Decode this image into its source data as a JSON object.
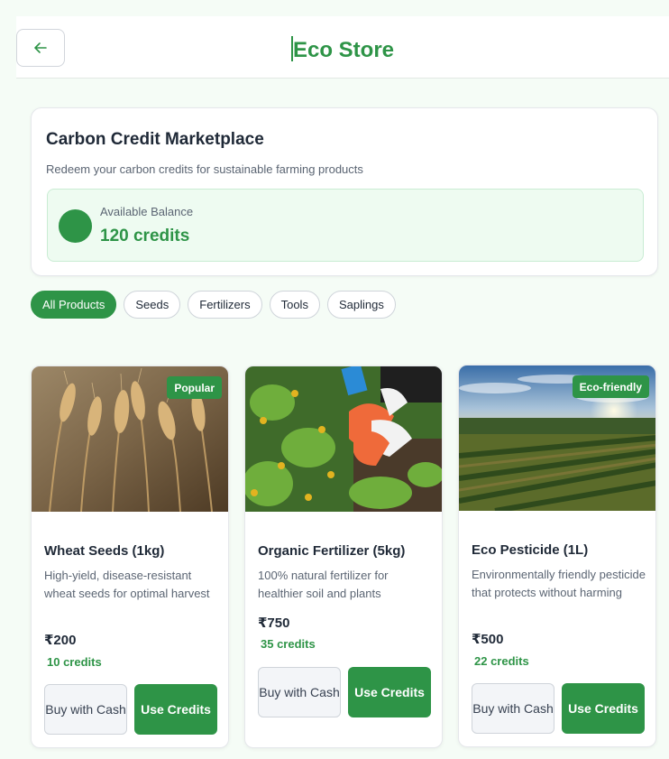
{
  "header": {
    "title": "Eco Store",
    "back_icon": "arrow-left-icon"
  },
  "marketplace": {
    "title": "Carbon Credit Marketplace",
    "subtitle": "Redeem your carbon credits for sustainable farming products",
    "balance_label": "Available Balance",
    "balance_value": "120 credits"
  },
  "filters": [
    "All Products",
    "Seeds",
    "Fertilizers",
    "Tools",
    "Saplings"
  ],
  "active_filter": "All Products",
  "products": [
    {
      "name": "Wheat Seeds (1kg)",
      "description": "High-yield, disease-resistant wheat seeds for optimal harvest",
      "price": "₹200",
      "credits": "10 credits",
      "badge": "Popular",
      "cash_label": "Buy with Cash",
      "credits_label": "Use Credits"
    },
    {
      "name": "Organic Fertilizer (5kg)",
      "description": "100% natural fertilizer for healthier soil and plants",
      "price": "₹750",
      "credits": "35 credits",
      "badge": "",
      "cash_label": "Buy with Cash",
      "credits_label": "Use Credits"
    },
    {
      "name": "Eco Pesticide (1L)",
      "description": "Environmentally friendly pesticide that protects without harming",
      "price": "₹500",
      "credits": "22 credits",
      "badge": "Eco-friendly",
      "cash_label": "Buy with Cash",
      "credits_label": "Use Credits"
    }
  ],
  "colors": {
    "accent": "#2e9447",
    "background": "#f5fcf6",
    "balance_bg": "#eefbf1"
  }
}
